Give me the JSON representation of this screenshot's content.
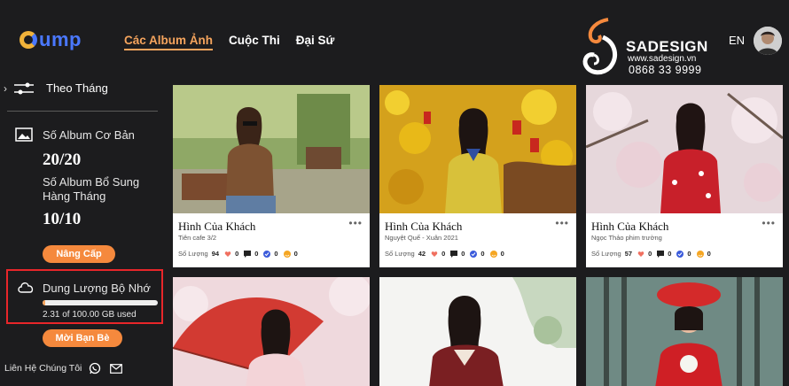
{
  "header": {
    "logo_text": "ump",
    "nav": [
      {
        "label": "Các Album Ảnh",
        "active": true
      },
      {
        "label": "Cuộc Thi",
        "active": false
      },
      {
        "label": "Đại Sứ",
        "active": false
      }
    ],
    "brand": {
      "name": "SADESIGN",
      "url": "www.sadesign.vn",
      "phone": "0868 33 9999"
    },
    "lang": "EN"
  },
  "sidebar": {
    "filter_label": "Theo Tháng",
    "album_basic_label": "Số Album Cơ Bản",
    "album_basic_value": "20/20",
    "album_extra_label": "Số Album Bổ Sung Hàng Tháng",
    "album_extra_value": "10/10",
    "upgrade_button": "Nâng Cấp",
    "storage_title": "Dung Lượng Bộ Nhớ",
    "storage_text": "2.31 of 100.00 GB used",
    "storage_used_fraction": 0.0231,
    "invite_button": "Mời Bạn Bè",
    "contact_label": "Liên Hệ Chúng Tôi"
  },
  "cards": [
    {
      "title": "Hình Của Khách",
      "subtitle": "Tiên cafe 3/2",
      "count_label": "Số Lượng",
      "count": "94",
      "likes": "0",
      "comments": "0",
      "checks": "0",
      "emoji": "0"
    },
    {
      "title": "Hình Của Khách",
      "subtitle": "Nguyệt Quế - Xuân 2021",
      "count_label": "Số Lượng",
      "count": "42",
      "likes": "0",
      "comments": "0",
      "checks": "0",
      "emoji": "0"
    },
    {
      "title": "Hình Của Khách",
      "subtitle": "Ngọc Thảo phim trường",
      "count_label": "Số Lượng",
      "count": "57",
      "likes": "0",
      "comments": "0",
      "checks": "0",
      "emoji": "0"
    }
  ],
  "colors": {
    "accent": "#f5893d",
    "nav_active": "#f5a45d",
    "highlight_border": "#e8262a",
    "background": "#1c1c1e"
  }
}
